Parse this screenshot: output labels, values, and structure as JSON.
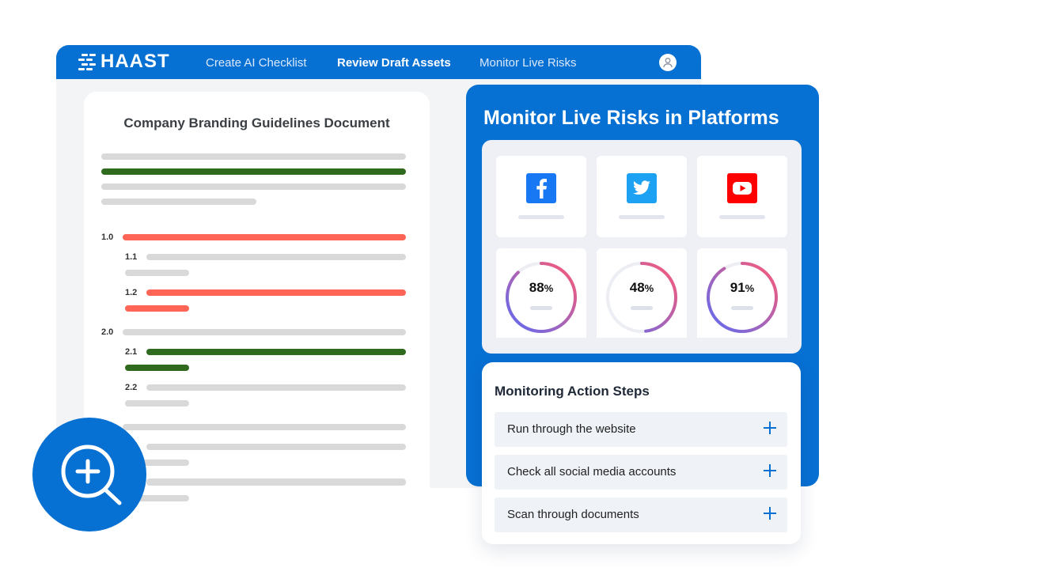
{
  "nav": {
    "brand": "HAAST",
    "items": [
      {
        "label": "Create AI Checklist",
        "active": false
      },
      {
        "label": "Review Draft Assets",
        "active": true
      },
      {
        "label": "Monitor Live Risks",
        "active": false
      }
    ],
    "profile_icon": "user-icon"
  },
  "document": {
    "title": "Company Branding Guidelines Document",
    "sections": [
      {
        "number": "1.0",
        "status": "red",
        "subsections": [
          {
            "number": "1.1",
            "status": "gray"
          },
          {
            "number": "1.2",
            "status": "red"
          }
        ]
      },
      {
        "number": "2.0",
        "status": "gray",
        "subsections": [
          {
            "number": "2.1",
            "status": "green"
          },
          {
            "number": "2.2",
            "status": "gray"
          }
        ]
      }
    ],
    "status_colors": {
      "green": "#2f6a1f",
      "red": "#fe6557",
      "gray": "#d9d9d9"
    }
  },
  "magnify_icon": "zoom-in-icon",
  "monitor": {
    "title": "Monitor Live Risks in Platforms",
    "platforms": [
      {
        "name_icon": "facebook-icon",
        "color": "#1877f2",
        "score": "88",
        "score_fraction": 0.88
      },
      {
        "name_icon": "twitter-icon",
        "color": "#1da1f2",
        "score": "48",
        "score_fraction": 0.48
      },
      {
        "name_icon": "youtube-icon",
        "color": "#ff0000",
        "score": "91",
        "score_fraction": 0.91
      }
    ],
    "percent_sign": "%"
  },
  "actions": {
    "title": "Monitoring Action Steps",
    "steps": [
      {
        "label": "Run through the website"
      },
      {
        "label": "Check all social media accounts"
      },
      {
        "label": "Scan through documents"
      }
    ]
  },
  "colors": {
    "brand_blue": "#0770d3",
    "gauge_start": "#5b6cf5",
    "gauge_end": "#ff5a73"
  }
}
